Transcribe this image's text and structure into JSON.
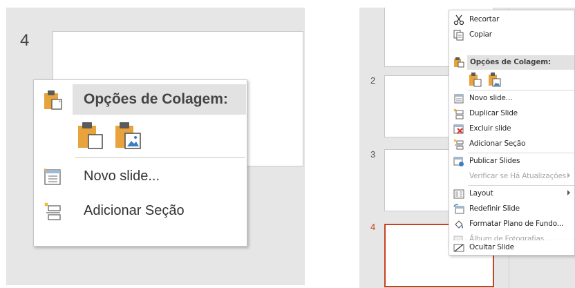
{
  "left_pane": {
    "slide_number": "4",
    "menu": {
      "header": "Opções de Colagem:",
      "paste_options": [
        {
          "icon": "paste-use-destination-theme-icon"
        },
        {
          "icon": "paste-picture-icon"
        }
      ],
      "items": [
        {
          "label": "Novo slide...",
          "icon": "new-slide-icon"
        },
        {
          "label": "Adicionar Seção",
          "icon": "add-section-icon"
        }
      ]
    }
  },
  "right_pane": {
    "slide_numbers": [
      "2",
      "3",
      "4"
    ],
    "selected_slide": "4",
    "menu": {
      "items": [
        {
          "label": "Recortar",
          "icon": "scissors-icon",
          "enabled": true
        },
        {
          "label": "Copiar",
          "icon": "copy-icon",
          "enabled": true
        },
        {
          "label": "Opções de Colagem:",
          "icon": "paste-icon",
          "header": true
        },
        {
          "label": "Novo slide...",
          "icon": "new-slide-icon",
          "enabled": true
        },
        {
          "label": "Duplicar Slide",
          "icon": "duplicate-slide-icon",
          "enabled": true
        },
        {
          "label": "Excluir slide",
          "icon": "delete-slide-icon",
          "enabled": true
        },
        {
          "label": "Adicionar Seção",
          "icon": "add-section-icon",
          "enabled": true
        },
        {
          "label": "Publicar Slides",
          "icon": "publish-slides-icon",
          "enabled": true
        },
        {
          "label": "Verificar se Há Atualizações",
          "icon": "",
          "enabled": false,
          "submenu": true
        },
        {
          "label": "Layout",
          "icon": "layout-icon",
          "enabled": true,
          "submenu": true
        },
        {
          "label": "Redefinir Slide",
          "icon": "reset-slide-icon",
          "enabled": true
        },
        {
          "label": "Formatar Plano de Fundo...",
          "icon": "format-background-icon",
          "enabled": true
        },
        {
          "label": "Álbum de Fotografias...",
          "icon": "photo-album-icon",
          "enabled": false
        },
        {
          "label": "Ocultar Slide",
          "icon": "hide-slide-icon",
          "enabled": true
        }
      ]
    }
  },
  "colors": {
    "pane_background": "#e6e6e6",
    "menu_header_background": "#e2e2e2",
    "selected_slide_border": "#c9421f",
    "disabled_text": "#a6a6a6",
    "paste_icon_orange": "#e8a33d"
  }
}
